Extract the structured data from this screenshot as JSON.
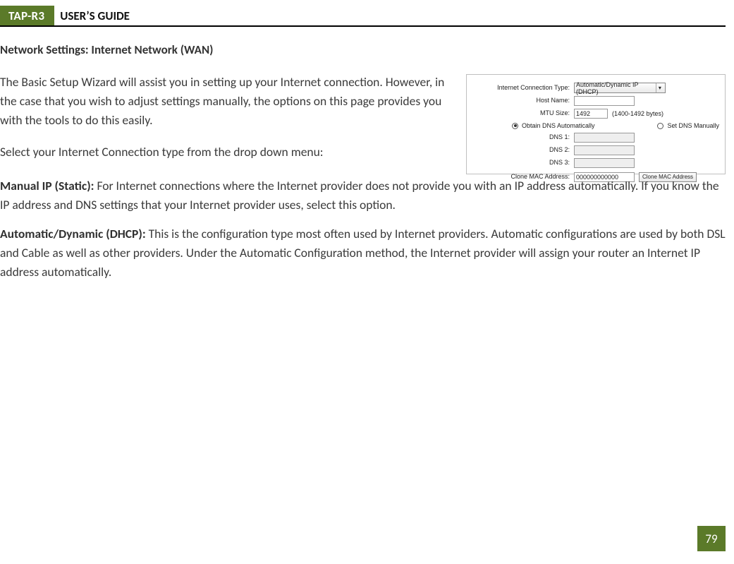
{
  "header": {
    "tab": "TAP-R3",
    "title": "USER’S GUIDE"
  },
  "section_title": "Network Settings: Internet Network (WAN)",
  "intro": {
    "p1": "The Basic Setup Wizard will assist you in setting up your Internet connection. However, in the case that you wish to adjust settings manually, the options on this page provides you with the tools to do this easily.",
    "p2": "Select your Internet Connection type from the drop down menu:"
  },
  "figure": {
    "conn_type_label": "Internet Connection Type:",
    "conn_type_value": "Automatic/Dynamic IP (DHCP)",
    "host_name_label": "Host Name:",
    "host_name_value": "",
    "mtu_label": "MTU Size:",
    "mtu_value": "1492",
    "mtu_hint": "(1400-1492 bytes)",
    "radio_auto": "Obtain DNS Automatically",
    "radio_manual": "Set DNS Manually",
    "dns1_label": "DNS 1:",
    "dns2_label": "DNS 2:",
    "dns3_label": "DNS 3:",
    "clone_label": "Clone MAC Address:",
    "clone_value": "000000000000",
    "clone_button": "Clone MAC Address"
  },
  "paragraphs": {
    "manual_label": "Manual IP (Static): ",
    "manual_text": "For Internet connections where the Internet provider does not provide you with an IP address automatically. If you know the IP address and DNS settings that your Internet provider uses, select this option.",
    "dhcp_label": "Automatic/Dynamic (DHCP): ",
    "dhcp_text": "This is the configuration type most often used by Internet providers. Automatic configurations are used by both DSL and Cable as well as other providers. Under the Automatic Configuration method, the Internet provider will assign your router an Internet IP address automatically."
  },
  "page_number": "79"
}
